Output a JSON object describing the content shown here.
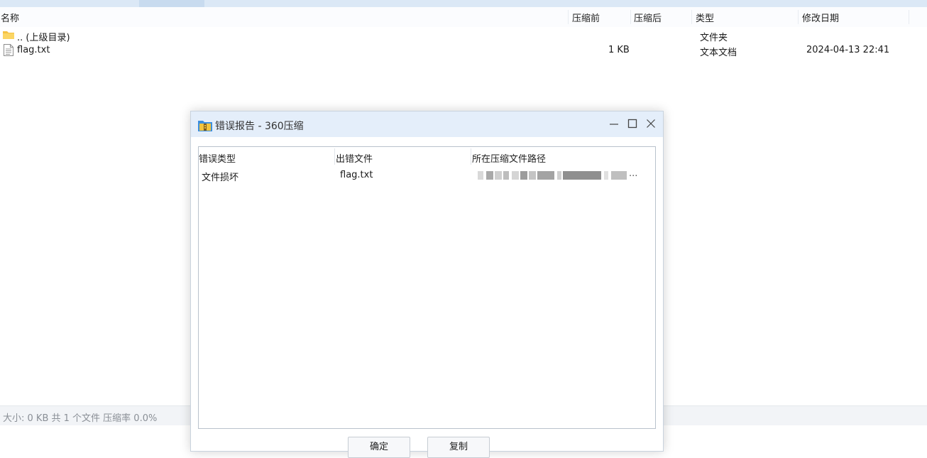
{
  "columns": {
    "name": "名称",
    "compressed_before": "压缩前",
    "compressed_after": "压缩后",
    "type": "类型",
    "modified": "修改日期"
  },
  "files": [
    {
      "name": ".. (上级目录)",
      "icon": "folder-icon",
      "size_before": "",
      "type": "文件夹",
      "modified": ""
    },
    {
      "name": "flag.txt",
      "icon": "text-file-icon",
      "size_before": "1 KB",
      "type": "文本文档",
      "modified": "2024-04-13 22:41"
    }
  ],
  "status_bar": {
    "text": "大小: 0 KB 共 1 个文件 压缩率 0.0%"
  },
  "dialog": {
    "title": "错误报告 - 360压缩",
    "columns": {
      "error_type": "错误类型",
      "error_file": "出错文件",
      "path": "所在压缩文件路径"
    },
    "rows": [
      {
        "error_type": "文件损坏",
        "error_file": "flag.txt",
        "path_tail": "..."
      }
    ],
    "buttons": {
      "ok": "确定",
      "copy": "复制"
    }
  },
  "colors": {
    "title_bar": "#e4eefa",
    "folder": "#f5c242",
    "status_text": "#8a8f96"
  }
}
